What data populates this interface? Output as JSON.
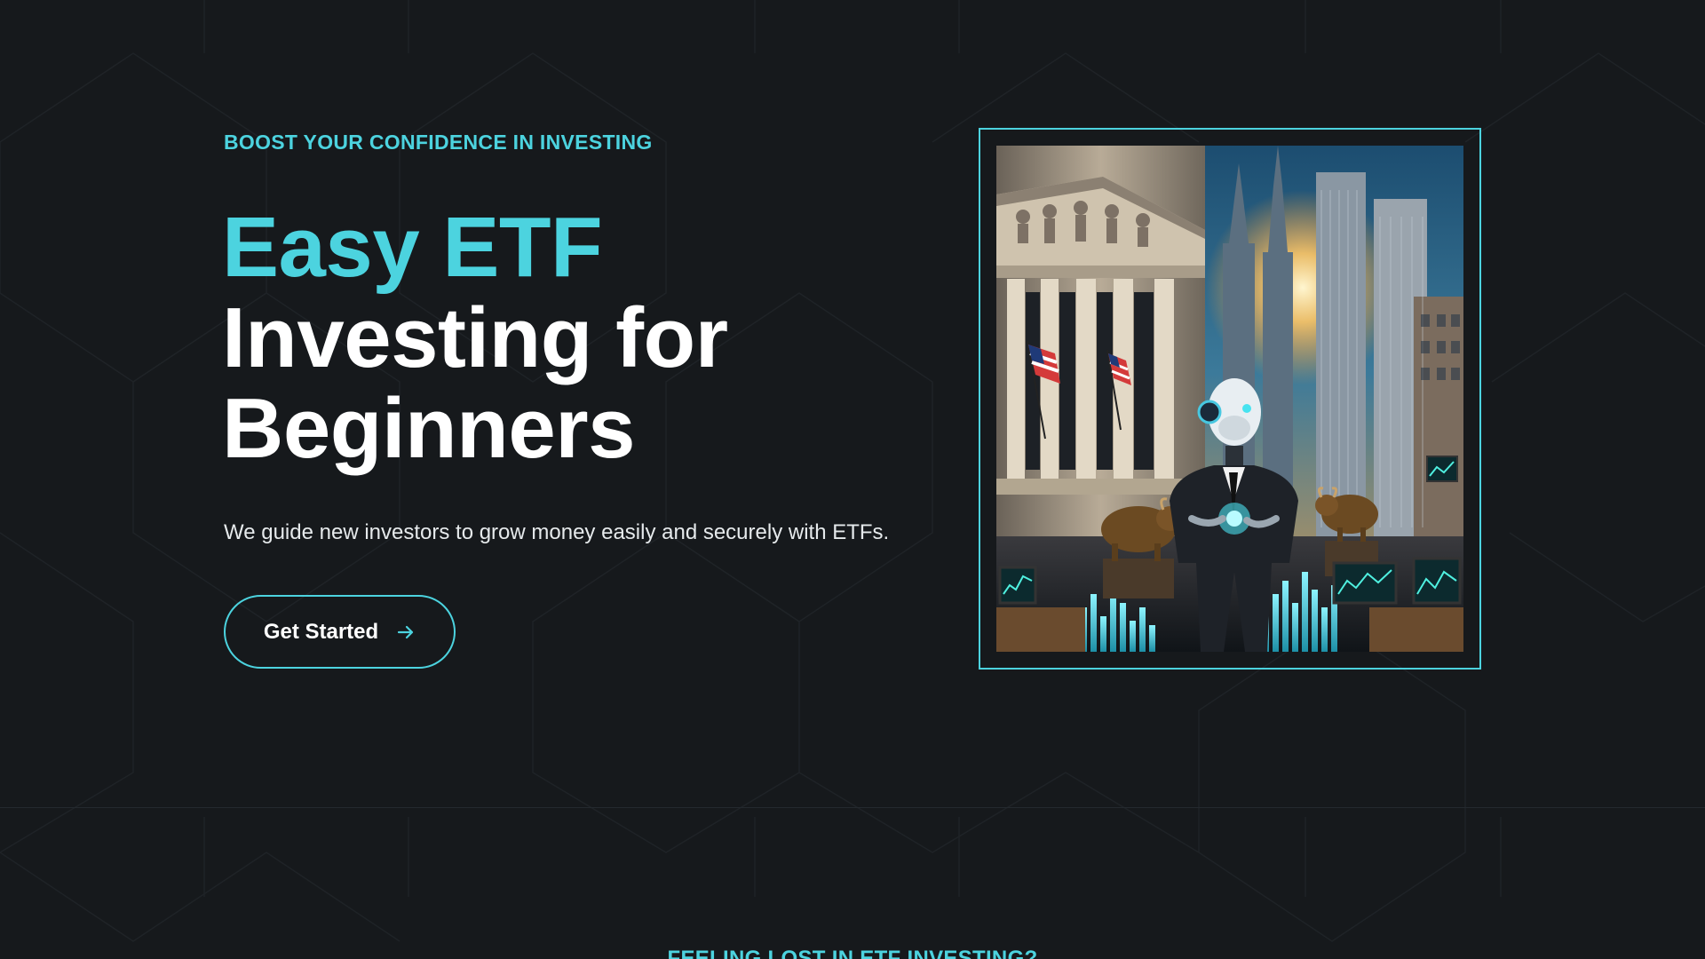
{
  "hero": {
    "eyebrow": "BOOST YOUR CONFIDENCE IN INVESTING",
    "headline_accent": "Easy ETF",
    "headline_line2": "Investing for",
    "headline_line3": "Beginners",
    "description": "We guide new investors to grow money easily and securely with ETFs.",
    "cta_label": "Get Started",
    "cta_icon": "arrow-right-icon",
    "image_subject": "robot-in-suit-wall-street-illustration"
  },
  "next_section": {
    "eyebrow": "FEELING LOST IN ETF INVESTING?"
  },
  "colors": {
    "background": "#16191c",
    "accent": "#4cd3df",
    "text": "#ffffff"
  }
}
